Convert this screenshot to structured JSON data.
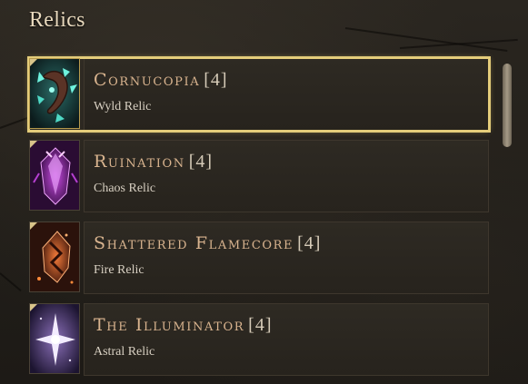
{
  "header": {
    "title": "Relics"
  },
  "relics": [
    {
      "name": "Cornucopia",
      "tier": "[4]",
      "type": "Wyld Relic",
      "icon": "cornucopia-icon",
      "selected": true
    },
    {
      "name": "Ruination",
      "tier": "[4]",
      "type": "Chaos Relic",
      "icon": "ruination-icon",
      "selected": false
    },
    {
      "name": "Shattered Flamecore",
      "tier": "[4]",
      "type": "Fire Relic",
      "icon": "flamecore-icon",
      "selected": false
    },
    {
      "name": "The Illuminator",
      "tier": "[4]",
      "type": "Astral Relic",
      "icon": "illuminator-icon",
      "selected": false
    }
  ],
  "colors": {
    "selection_border": "#e4cc7a",
    "name_text": "#d9b48f",
    "wyld": "#3fd6c2",
    "chaos": "#b23ad0",
    "fire": "#d8531c",
    "astral": "#e6dcf7"
  }
}
